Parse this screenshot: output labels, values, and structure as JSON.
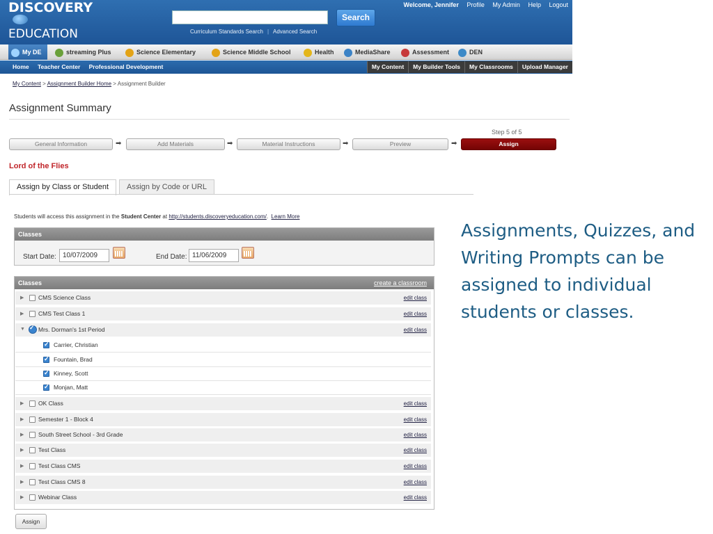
{
  "header": {
    "logo_line1": "DISCOVERY",
    "logo_line2": "EDUCATION",
    "search_button": "Search",
    "search_value": "",
    "links": [
      "Curriculum Standards Search",
      "Advanced Search"
    ],
    "welcome": "Welcome, Jennifer",
    "top_links": [
      "Profile",
      "My Admin",
      "Help",
      "Logout"
    ]
  },
  "nav": {
    "tabs": [
      {
        "label": "My DE",
        "color": "#2a64a4"
      },
      {
        "label": "streaming Plus",
        "color": "#6aa03a"
      },
      {
        "label": "Science Elementary",
        "color": "#e3a316"
      },
      {
        "label": "Science Middle School",
        "color": "#e3a316"
      },
      {
        "label": "Health",
        "color": "#e4b61a"
      },
      {
        "label": "MediaShare",
        "color": "#3c83c6"
      },
      {
        "label": "Assessment",
        "color": "#c73a3a"
      },
      {
        "label": "DEN",
        "color": "#3d8ac7"
      }
    ]
  },
  "subnav": {
    "left": [
      "Home",
      "Teacher Center",
      "Professional Development"
    ],
    "right": [
      "My Content",
      "My Builder Tools",
      "My Classrooms",
      "Upload Manager"
    ]
  },
  "breadcrumb": [
    "My Content",
    "Assignment Builder Home",
    "Assignment Builder"
  ],
  "page": {
    "title": "Assignment Summary",
    "step_label": "Step 5 of 5",
    "steps": [
      "General Information",
      "Add Materials",
      "Material Instructions",
      "Preview",
      "Assign"
    ],
    "assignment_title": "Lord of the Flies",
    "tabs": [
      "Assign by Class or Student",
      "Assign by Code or URL"
    ]
  },
  "access_note": {
    "prefix": "Students will access this assignment in the ",
    "center": "Student Center",
    "mid": " at ",
    "url": "http://students.discoveryeducation.com/",
    "dot": ".",
    "learn_more": "Learn More"
  },
  "dates": {
    "header": "Classes",
    "start_label": "Start Date:",
    "start_value": "10/07/2009",
    "end_label": "End Date:",
    "end_value": "11/06/2009"
  },
  "classes": {
    "header": "Classes",
    "create_link": "create a classroom",
    "edit_label": "edit class",
    "rows": [
      {
        "name": "CMS Science Class",
        "checked": false
      },
      {
        "name": "CMS Test Class 1",
        "checked": false
      },
      {
        "name": "Mrs. Dorman's 1st Period",
        "checked": true,
        "students": [
          "Carrier, Christian",
          "Fountain, Brad",
          "Kinney, Scott",
          "Monjan, Matt"
        ]
      },
      {
        "name": "OK Class",
        "checked": false
      },
      {
        "name": "Semester 1 - Block 4",
        "checked": false
      },
      {
        "name": "South Street School - 3rd Grade",
        "checked": false
      },
      {
        "name": "Test Class",
        "checked": false
      },
      {
        "name": "Test Class CMS",
        "checked": false
      },
      {
        "name": "Test Class CMS 8",
        "checked": false
      },
      {
        "name": "Webinar Class",
        "checked": false
      }
    ]
  },
  "assign_button": "Assign",
  "caption": "Assignments, Quizzes, and Writing Prompts can be assigned to individual students or classes."
}
